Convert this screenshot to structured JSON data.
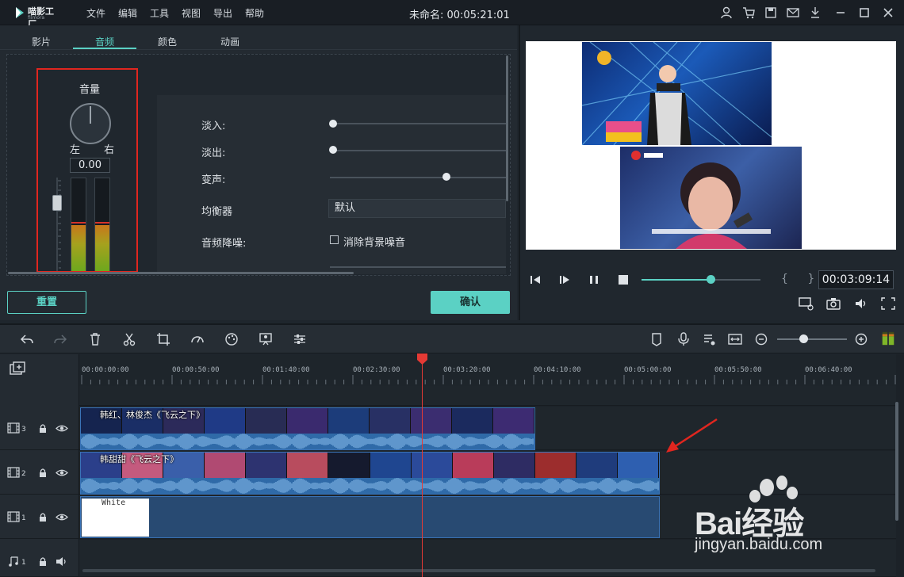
{
  "app": {
    "logo_text": "喵影工厂",
    "logo_sub": "filmora",
    "document_title": "未命名: 00:05:21:01"
  },
  "menu": [
    "文件",
    "编辑",
    "工具",
    "视图",
    "导出",
    "帮助"
  ],
  "title_icons": [
    "user-icon",
    "cart-icon",
    "save-icon",
    "mail-icon",
    "download-icon",
    "minimize-icon",
    "maximize-icon",
    "close-icon"
  ],
  "panel_tabs": [
    "影片",
    "音频",
    "颜色",
    "动画"
  ],
  "active_tab": "音频",
  "volume": {
    "title": "音量",
    "left": "左",
    "right": "右",
    "value": "0.00",
    "meter_left_level": 0.5,
    "meter_right_level": 0.5
  },
  "audio_props": {
    "fade_in": {
      "label": "淡入:",
      "value": 0.0
    },
    "fade_out": {
      "label": "淡出:",
      "value": 0.0
    },
    "pitch": {
      "label": "变声:",
      "value": 0.68
    },
    "equalizer": {
      "label": "均衡器",
      "value": "默认"
    },
    "denoise": {
      "label": "音频降噪:",
      "checkbox_label": "消除背景噪音",
      "checked": false
    }
  },
  "buttons": {
    "reset": "重置",
    "ok": "确认"
  },
  "preview": {
    "timecode": "00:03:09:14",
    "progress": 0.59,
    "brackets": "{ }"
  },
  "ruler": [
    "00:00:00:00",
    "00:00:50:00",
    "00:01:40:00",
    "00:02:30:00",
    "00:03:20:00",
    "00:04:10:00",
    "00:05:00:00",
    "00:05:50:00",
    "00:06:40:00"
  ],
  "tracks": [
    {
      "num": "3",
      "clip_title": "韩红、林俊杰《飞云之下》"
    },
    {
      "num": "2",
      "clip_title": "韩甜甜《飞云之下》"
    },
    {
      "num": "1",
      "clip_title": "White"
    },
    {
      "num": "1"
    }
  ],
  "colors": {
    "accent": "#5bd1c4",
    "highlight_box": "#e0261f",
    "playhead": "#e53a35",
    "clip": "#2a5b94"
  },
  "watermark": {
    "brand": "Bai经验",
    "url": "jingyan.baidu.com"
  }
}
